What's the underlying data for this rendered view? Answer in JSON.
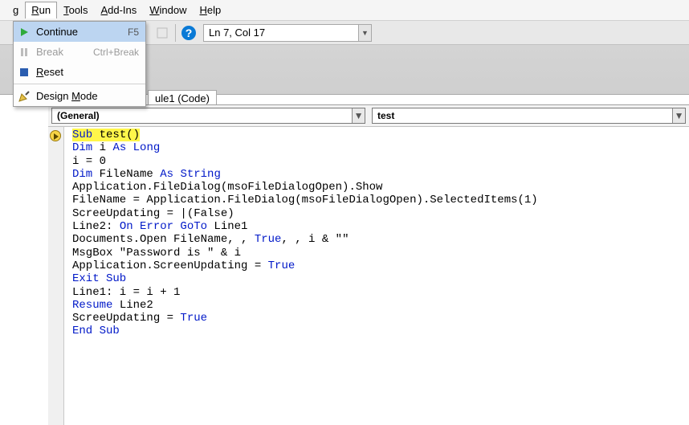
{
  "menubar": {
    "partial_g": "g",
    "run": "Run",
    "tools": "Tools",
    "addins": "Add-Ins",
    "window": "Window",
    "help": "Help"
  },
  "run_menu": {
    "continue": "Continue",
    "continue_sc": "F5",
    "break": "Break",
    "break_sc": "Ctrl+Break",
    "reset": "Reset",
    "design": "Design Mode"
  },
  "toolbar": {
    "position": "Ln 7, Col 17"
  },
  "document_tab": "ule1 (Code)",
  "combo_left": "(General)",
  "combo_right": "test",
  "code": {
    "l1a": "Sub",
    "l1b": " test()",
    "l2a": "Dim",
    "l2b": " i ",
    "l2c": "As Long",
    "l3": "i = 0",
    "l4a": "Dim",
    "l4b": " FileName ",
    "l4c": "As String",
    "l5": "Application.FileDialog(msoFileDialogOpen).Show",
    "l6": "FileName = Application.FileDialog(msoFileDialogOpen).SelectedItems(1)",
    "l7": "ScreeUpdating = |(False)",
    "l8a": "Line2: ",
    "l8b": "On Error GoTo",
    "l8c": " Line1",
    "l9a": "Documents.Open FileName, , ",
    "l9b": "True",
    "l9c": ", , i & \"\"",
    "l10": "MsgBox \"Password is \" & i",
    "l11a": "Application.ScreenUpdating = ",
    "l11b": "True",
    "l12": "Exit Sub",
    "l13": "Line1: i = i + 1",
    "l14a": "Resume",
    "l14b": " Line2",
    "l15a": "ScreeUpdating = ",
    "l15b": "True",
    "l16": "End Sub"
  }
}
